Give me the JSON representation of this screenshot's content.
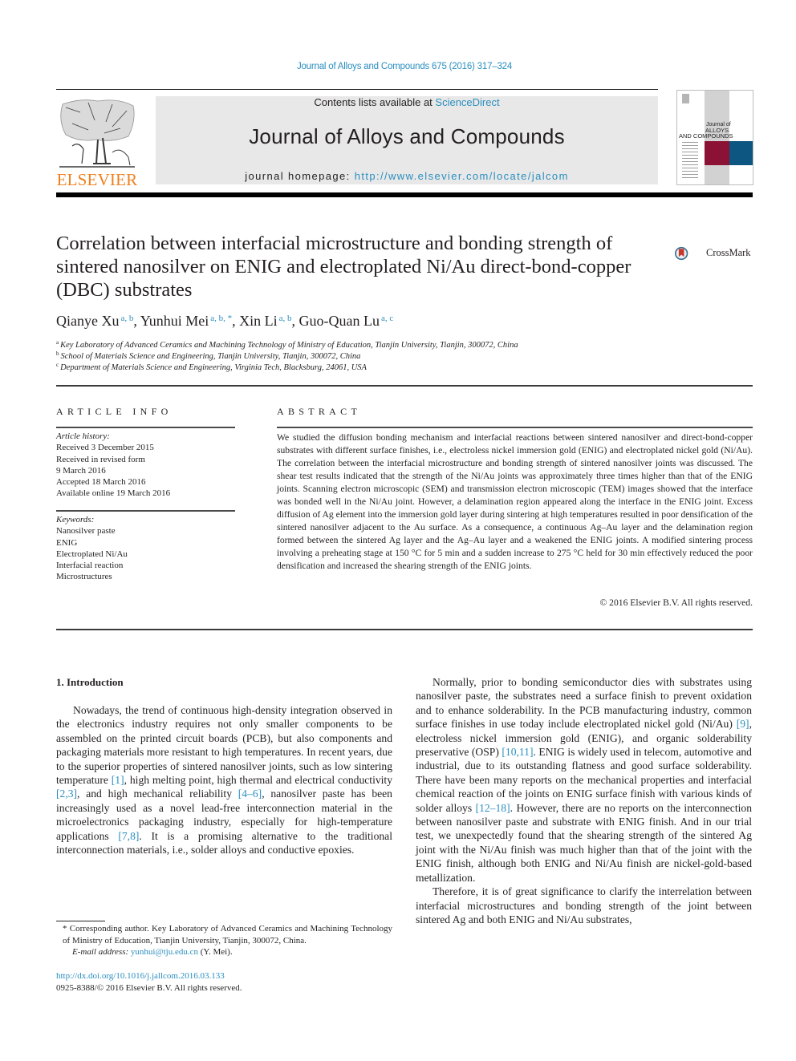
{
  "header": {
    "citation": "Journal of Alloys and Compounds 675 (2016) 317–324",
    "contents_prefix": "Contents lists available at ",
    "contents_link": "ScienceDirect",
    "journal_name": "Journal of Alloys and Compounds",
    "homepage_prefix": "journal homepage: ",
    "homepage_link": "http://www.elsevier.com/locate/jalcom",
    "publisher_logo_text": "ELSEVIER",
    "cover": {
      "line1": "Journal of",
      "line2": "ALLOYS",
      "line3": "AND COMPOUNDS"
    },
    "colors": {
      "elsevier_orange": "#f07f1d",
      "link_blue": "#2a8ebf",
      "cover_maroon": "#8b1234",
      "cover_blue": "#0d5682",
      "masthead_gray": "#e8e8e8"
    }
  },
  "article": {
    "title": "Correlation between interfacial microstructure and bonding strength of sintered nanosilver on ENIG and electroplated Ni/Au direct-bond-copper (DBC) substrates",
    "crossmark_label": "CrossMark",
    "authors": [
      {
        "name": "Qianye Xu",
        "affil": "a, b",
        "sep": ", "
      },
      {
        "name": "Yunhui Mei",
        "affil": "a, b, *",
        "sep": ", "
      },
      {
        "name": "Xin Li",
        "affil": "a, b",
        "sep": ", "
      },
      {
        "name": "Guo-Quan Lu",
        "affil": "a, c",
        "sep": ""
      }
    ],
    "affiliations": [
      {
        "mark": "a",
        "text": "Key Laboratory of Advanced Ceramics and Machining Technology of Ministry of Education, Tianjin University, Tianjin, 300072, China"
      },
      {
        "mark": "b",
        "text": "School of Materials Science and Engineering, Tianjin University, Tianjin, 300072, China"
      },
      {
        "mark": "c",
        "text": "Department of Materials Science and Engineering, Virginia Tech, Blacksburg, 24061, USA"
      }
    ]
  },
  "article_info": {
    "heading": "ARTICLE INFO",
    "history_label": "Article history:",
    "history": [
      "Received 3 December 2015",
      "Received in revised form",
      "9 March 2016",
      "Accepted 18 March 2016",
      "Available online 19 March 2016"
    ],
    "keywords_label": "Keywords:",
    "keywords": [
      "Nanosilver paste",
      "ENIG",
      "Electroplated Ni/Au",
      "Interfacial reaction",
      "Microstructures"
    ]
  },
  "abstract": {
    "heading": "ABSTRACT",
    "text": "We studied the diffusion bonding mechanism and interfacial reactions between sintered nanosilver and direct-bond-copper substrates with different surface finishes, i.e., electroless nickel immersion gold (ENIG) and electroplated nickel gold (Ni/Au). The correlation between the interfacial microstructure and bonding strength of sintered nanosilver joints was discussed. The shear test results indicated that the strength of the Ni/Au joints was approximately three times higher than that of the ENIG joints. Scanning electron microscopic (SEM) and transmission electron microscopic (TEM) images showed that the interface was bonded well in the Ni/Au joint. However, a delamination region appeared along the interface in the ENIG joint. Excess diffusion of Ag element into the immersion gold layer during sintering at high temperatures resulted in poor densification of the sintered nanosilver adjacent to the Au surface. As a consequence, a continuous Ag–Au layer and the delamination region formed between the sintered Ag layer and the Ag–Au layer and a weakened the ENIG joints. A modified sintering process involving a preheating stage at 150 °C for 5 min and a sudden increase to 275 °C held for 30 min effectively reduced the poor densification and increased the shearing strength of the ENIG joints.",
    "copyright": "© 2016 Elsevier B.V. All rights reserved."
  },
  "body": {
    "section_heading": "1.  Introduction",
    "left_paragraphs": [
      [
        {
          "t": "Nowadays, the trend of continuous high-density integration observed in the electronics industry requires not only smaller components to be assembled on the printed circuit boards (PCB), but also components and packaging materials more resistant to high temperatures. In recent years, due to the superior properties of sintered nanosilver joints, such as low sintering temperature "
        },
        {
          "ref": "[1]"
        },
        {
          "t": ", high melting point, high thermal and electrical conductivity "
        },
        {
          "ref": "[2,3]"
        },
        {
          "t": ", and high mechanical reliability "
        },
        {
          "ref": "[4–6]"
        },
        {
          "t": ", nanosilver paste has been increasingly used as a novel lead-free interconnection material in the microelectronics packaging industry, especially for high-temperature applications "
        },
        {
          "ref": "[7,8]"
        },
        {
          "t": ". It is a promising alternative to the traditional interconnection materials, i.e., solder alloys and conductive epoxies."
        }
      ]
    ],
    "right_paragraphs": [
      [
        {
          "t": "Normally, prior to bonding semiconductor dies with substrates using nanosilver paste, the substrates need a surface finish to prevent oxidation and to enhance solderability. In the PCB manufacturing industry, common surface finishes in use today include electroplated nickel gold (Ni/Au) "
        },
        {
          "ref": "[9]"
        },
        {
          "t": ", electroless nickel immersion gold (ENIG), and organic solderability preservative (OSP) "
        },
        {
          "ref": "[10,11]"
        },
        {
          "t": ". ENIG is widely used in telecom, automotive and industrial, due to its outstanding flatness and good surface solderability. There have been many reports on the mechanical properties and interfacial chemical reaction of the joints on ENIG surface finish with various kinds of solder alloys "
        },
        {
          "ref": "[12–18]"
        },
        {
          "t": ". However, there are no reports on the interconnection between nanosilver paste and substrate with ENIG finish. And in our trial test, we unexpectedly found that the shearing strength of the sintered Ag joint with the Ni/Au finish was much higher than that of the joint with the ENIG finish, although both ENIG and Ni/Au finish are nickel-gold-based metallization."
        }
      ],
      [
        {
          "t": "Therefore, it is of great significance to clarify the interrelation between interfacial microstructures and bonding strength of the joint between sintered Ag and both ENIG and Ni/Au substrates,"
        }
      ]
    ]
  },
  "footer": {
    "footnote_mark": "*",
    "footnote_text": " Corresponding author. Key Laboratory of Advanced Ceramics and Machining Technology of Ministry of Education, Tianjin University, Tianjin, 300072, China.",
    "email_label": "E-mail address: ",
    "email": "yunhui@tju.edu.cn",
    "email_suffix": " (Y. Mei).",
    "doi": "http://dx.doi.org/10.1016/j.jallcom.2016.03.133",
    "issn": "0925-8388/© 2016 Elsevier B.V. All rights reserved."
  }
}
